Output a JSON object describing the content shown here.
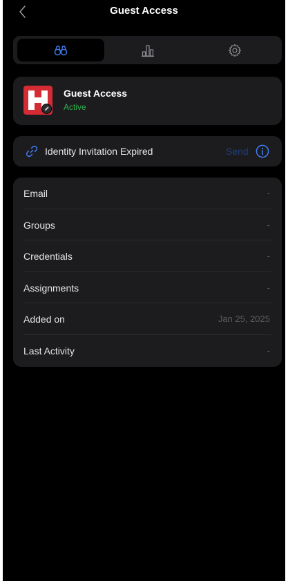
{
  "nav": {
    "title": "Guest Access"
  },
  "tabs": [
    {
      "name": "overview",
      "icon": "binoculars-icon",
      "active": true
    },
    {
      "name": "stats",
      "icon": "bar-chart-icon",
      "active": false
    },
    {
      "name": "settings",
      "icon": "gear-icon",
      "active": false
    }
  ],
  "profile": {
    "name": "Guest Access",
    "status": "Active"
  },
  "invitation": {
    "text": "Identity Invitation Expired",
    "action": "Send"
  },
  "details": [
    {
      "label": "Email",
      "value": "-"
    },
    {
      "label": "Groups",
      "value": "-"
    },
    {
      "label": "Credentials",
      "value": "-"
    },
    {
      "label": "Assignments",
      "value": "-"
    },
    {
      "label": "Added on",
      "value": "Jan 25, 2025"
    },
    {
      "label": "Last Activity",
      "value": "-"
    }
  ],
  "colors": {
    "accent": "#2f6ff0",
    "status_active": "#2fb14d",
    "logo": "#d52b35",
    "card": "#1c1c1e"
  }
}
